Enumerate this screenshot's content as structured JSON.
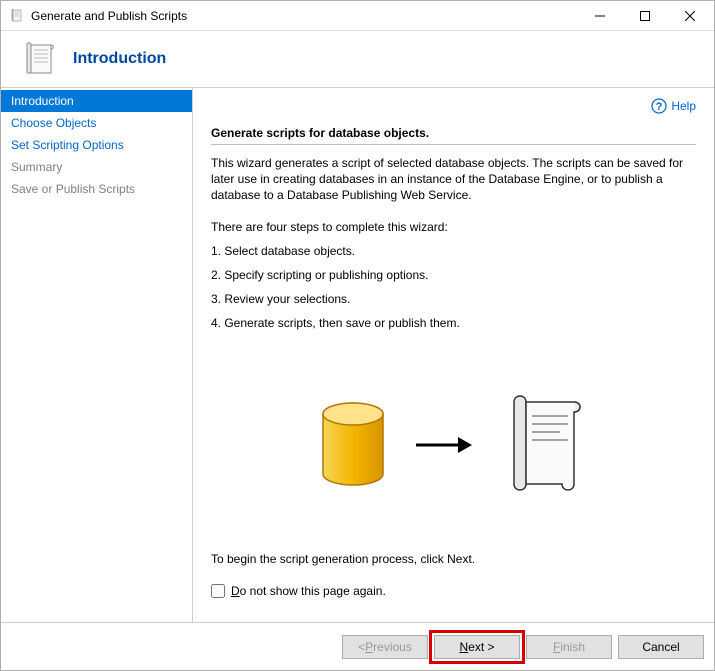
{
  "window": {
    "title": "Generate and Publish Scripts"
  },
  "header": {
    "title": "Introduction"
  },
  "sidebar": {
    "items": [
      {
        "label": "Introduction",
        "selected": true
      },
      {
        "label": "Choose Objects"
      },
      {
        "label": "Set Scripting Options"
      },
      {
        "label": "Summary",
        "muted": true
      },
      {
        "label": "Save or Publish Scripts",
        "muted": true
      }
    ]
  },
  "help": {
    "label": "Help"
  },
  "content": {
    "section_title": "Generate scripts for database objects.",
    "description": "This wizard generates a script of selected database objects. The scripts can be saved for later use in creating databases in an instance of the Database Engine, or to publish a database to a Database Publishing Web Service.",
    "steps_intro": "There are four steps to complete this wizard:",
    "steps": [
      "1. Select database objects.",
      "2. Specify scripting or publishing options.",
      "3. Review your selections.",
      "4. Generate scripts, then save or publish them."
    ],
    "begin": "To begin the script generation process, click Next.",
    "checkbox_prefix": "D",
    "checkbox_rest": "o not show this page again."
  },
  "footer": {
    "previous_u": "P",
    "previous_prefix": "< ",
    "previous_rest": "revious",
    "next_u": "N",
    "next_rest": "ext >",
    "finish_u": "F",
    "finish_rest": "inish",
    "cancel": "Cancel"
  }
}
